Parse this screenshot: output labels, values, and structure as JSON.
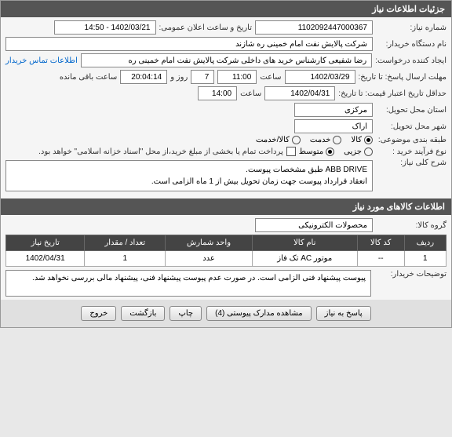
{
  "header": {
    "title": "جزئیات اطلاعات نیاز"
  },
  "form": {
    "need_number_label": "شماره نیاز:",
    "need_number": "1102092447000367",
    "announce_datetime_label": "تاریخ و ساعت اعلان عمومی:",
    "announce_datetime": "1402/03/21 - 14:50",
    "buyer_org_label": "نام دستگاه خریدار:",
    "buyer_org": "شرکت پالایش نفت امام خمینی ره  شازند",
    "requester_label": "ایجاد کننده درخواست:",
    "requester": "رضا  شفیعی  کارشناس خرید های داخلی  شرکت پالایش نفت امام خمینی ره",
    "contact_link": "اطلاعات تماس خریدار",
    "deadline_label": "مهلت ارسال پاسخ: تا تاریخ:",
    "deadline_date": "1402/03/29",
    "time_label": "ساعت",
    "deadline_time": "11:00",
    "days_label": "روز و",
    "days_value": "7",
    "remaining_label": "ساعت باقی مانده",
    "remaining_time": "20:04:14",
    "validity_label": "حداقل تاریخ اعتبار قیمت: تا تاریخ:",
    "validity_date": "1402/04/31",
    "validity_time": "14:00",
    "delivery_province_label": "استان محل تحویل:",
    "delivery_province": "مرکزی",
    "delivery_city_label": "شهر محل تحویل:",
    "delivery_city": "اراک",
    "category_label": "طبقه بندی موضوعی:",
    "cat_options": {
      "goods": "کالا",
      "service": "خدمت",
      "both": "کالا/خدمت"
    },
    "process_label": "نوع فرآیند خرید :",
    "proc_options": {
      "minor": "جزیی",
      "medium": "متوسط"
    },
    "payment_note": "پرداخت تمام یا بخشی از مبلغ خرید،از محل \"اسناد خزانه اسلامی\" خواهد بود.",
    "need_desc_label": "شرح کلی نیاز:",
    "need_desc_line1": "ABB DRIVE طبق مشخصات پیوست.",
    "need_desc_line2": "انعقاد قرارداد پیوست جهت زمان تحویل بیش از 1 ماه الزامی است."
  },
  "goods_section": {
    "title": "اطلاعات کالاهای مورد نیاز",
    "group_label": "گروه کالا:",
    "group_value": "محصولات الکترونیکی"
  },
  "table": {
    "headers": {
      "row": "ردیف",
      "code": "کد کالا",
      "name": "نام کالا",
      "unit": "واحد شمارش",
      "qty": "تعداد / مقدار",
      "date": "تاریخ نیاز"
    },
    "rows": [
      {
        "row": "1",
        "code": "--",
        "name": "موتور AC تک فاز",
        "unit": "عدد",
        "qty": "1",
        "date": "1402/04/31"
      }
    ]
  },
  "buyer_notes": {
    "label": "توضیحات خریدار:",
    "text": "پیوست پیشنهاد فنی الزامی است. در صورت عدم پیوست پیشنهاد فنی، پیشنهاد مالی بررسی نخواهد شد."
  },
  "buttons": {
    "respond": "پاسخ به نیاز",
    "attachments": "مشاهده مدارک پیوستی (4)",
    "print": "چاپ",
    "back": "بازگشت",
    "exit": "خروج"
  }
}
